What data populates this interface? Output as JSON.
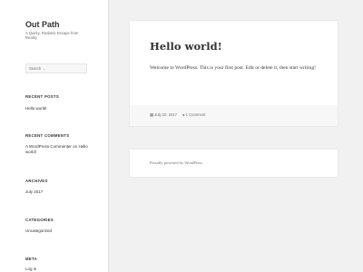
{
  "site": {
    "title": "Out Path",
    "description": "A Quirky, Realistic Escape from Reality"
  },
  "search": {
    "placeholder": "Search …"
  },
  "sidebar": {
    "recent_posts": {
      "title": "RECENT POSTS",
      "items": [
        "Hello world!"
      ]
    },
    "recent_comments": {
      "title": "RECENT COMMENTS",
      "items": [
        "A WordPress Commenter on Hello world!"
      ]
    },
    "archives": {
      "title": "ARCHIVES",
      "items": [
        "July 2017"
      ]
    },
    "categories": {
      "title": "CATEGORIES",
      "items": [
        "Uncategorized"
      ]
    },
    "meta": {
      "title": "META",
      "items": [
        "Log in"
      ]
    }
  },
  "post": {
    "title": "Hello world!",
    "body": "Welcome to WordPress. This is your first post. Edit or delete it, then start writing!",
    "date": "July 20, 2017",
    "comments": "1 Comment",
    "date_icon": "calendar-icon",
    "comment_icon": "speech-bubble-icon"
  },
  "footer": {
    "text": "Proudly powered by WordPress"
  }
}
